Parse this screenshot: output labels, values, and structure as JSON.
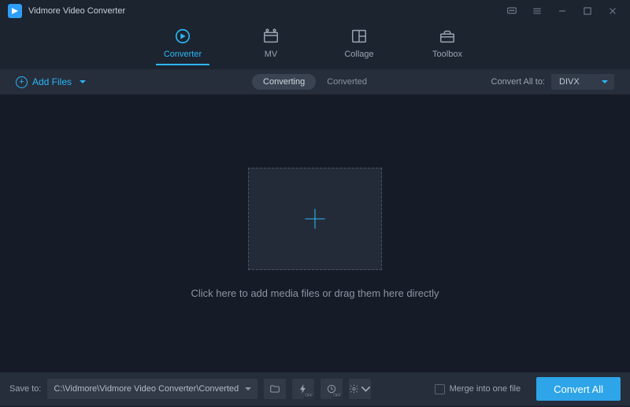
{
  "app": {
    "title": "Vidmore Video Converter"
  },
  "topnav": {
    "tabs": [
      {
        "label": "Converter",
        "active": true
      },
      {
        "label": "MV",
        "active": false
      },
      {
        "label": "Collage",
        "active": false
      },
      {
        "label": "Toolbox",
        "active": false
      }
    ]
  },
  "secondbar": {
    "addFilesLabel": "Add Files",
    "segments": {
      "converting": "Converting",
      "converted": "Converted"
    },
    "convertAllToLabel": "Convert All to:",
    "selectedFormat": "DIVX"
  },
  "dropzone": {
    "hint": "Click here to add media files or drag them here directly"
  },
  "bottombar": {
    "saveToLabel": "Save to:",
    "savePath": "C:\\Vidmore\\Vidmore Video Converter\\Converted",
    "offBadge": "OFF",
    "mergeLabel": "Merge into one file",
    "convertAllLabel": "Convert All"
  }
}
